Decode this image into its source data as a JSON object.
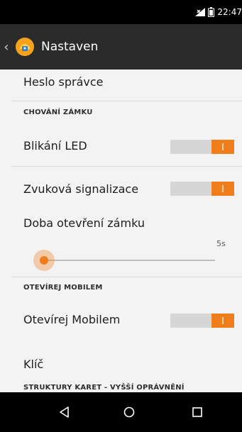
{
  "status_bar": {
    "time": "22:47",
    "icons": [
      "signal-icon",
      "battery-icon"
    ]
  },
  "action_bar": {
    "title": "Nastaven",
    "icons": [
      "back-chevron-icon",
      "app-icon"
    ]
  },
  "preferences": {
    "admin_password": "Heslo správce",
    "category_lock": "CHOVÁNÍ ZÁMKU",
    "led_blinking": {
      "label": "Blikání LED",
      "enabled": true
    },
    "sound_signal": {
      "label": "Zvuková signalizace",
      "enabled": true
    },
    "lock_open_time": {
      "label": "Doba otevření zámku",
      "value_text": "5s",
      "fraction": 0.0
    },
    "category_mobile": "OTEVÍREJ MOBILEM",
    "open_mobile": {
      "label": "Otevírej Mobilem",
      "enabled": true
    },
    "key": "Klíč",
    "category_card": "STRUKTURY KARET - VYŠŠÍ OPRÁVNĚNÍ"
  },
  "nav_bar": {
    "icons": [
      "back-icon",
      "home-icon",
      "recents-icon"
    ]
  },
  "colors": {
    "accent": "#f07d1c",
    "action_bar": "#2b2b2b",
    "background": "#f3f3f3"
  }
}
